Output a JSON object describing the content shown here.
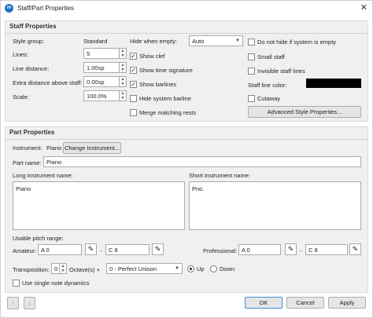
{
  "window": {
    "title": "Staff/Part Properties",
    "app_icon_text": "m",
    "close_glyph": "✕"
  },
  "staff": {
    "heading": "Staff Properties",
    "style_group_label": "Style group:",
    "style_group_value": "Standard",
    "lines_label": "Lines:",
    "lines_value": "5",
    "line_distance_label": "Line distance:",
    "line_distance_value": "1.00sp",
    "extra_distance_label": "Extra distance above staff:",
    "extra_distance_value": "0.00sp",
    "scale_label": "Scale:",
    "scale_value": "100.0%",
    "hide_when_empty_label": "Hide when empty:",
    "hide_when_empty_value": "Auto",
    "show_clef": "Show clef",
    "show_time_signature": "Show time signature",
    "show_barlines": "Show barlines",
    "hide_system_barline": "Hide system barline",
    "merge_matching_rests": "Merge matching rests",
    "do_not_hide": "Do not hide if system is empty",
    "small_staff": "Small staff",
    "invisible_staff_lines": "Invisible staff lines",
    "staff_line_color_label": "Staff line color:",
    "staff_line_color": "#000000",
    "cutaway": "Cutaway",
    "advanced_button": "Advanced Style Properties...",
    "checked_mark": "✓"
  },
  "part": {
    "heading": "Part Properties",
    "instrument_label": "Instrument:",
    "instrument_value": "Piano",
    "change_instrument_button": "Change Instrument...",
    "part_name_label": "Part name:",
    "part_name_value": "Piano",
    "long_name_label": "Long instrument name:",
    "long_name_value": "Piano",
    "short_name_label": "Short instrument name:",
    "short_name_value": "Pno.",
    "usable_range_label": "Usable pitch range:",
    "amateur_label": "Amateur:",
    "amateur_low": "A 0",
    "amateur_high": "C 8",
    "professional_label": "Professional:",
    "pro_low": "A 0",
    "pro_high": "C 8",
    "range_dash": "-",
    "pen_glyph": "✎",
    "transposition_label": "Transposition:",
    "transposition_value": "0",
    "octaves_label": "Octave(s) +",
    "interval_value": "0 - Perfect Unison",
    "up_label": "Up",
    "down_label": "Down",
    "single_note_dynamics": "Use single note dynamics"
  },
  "footer": {
    "prev_glyph": "↑",
    "next_glyph": "↓",
    "ok": "OK",
    "cancel": "Cancel",
    "apply": "Apply"
  }
}
